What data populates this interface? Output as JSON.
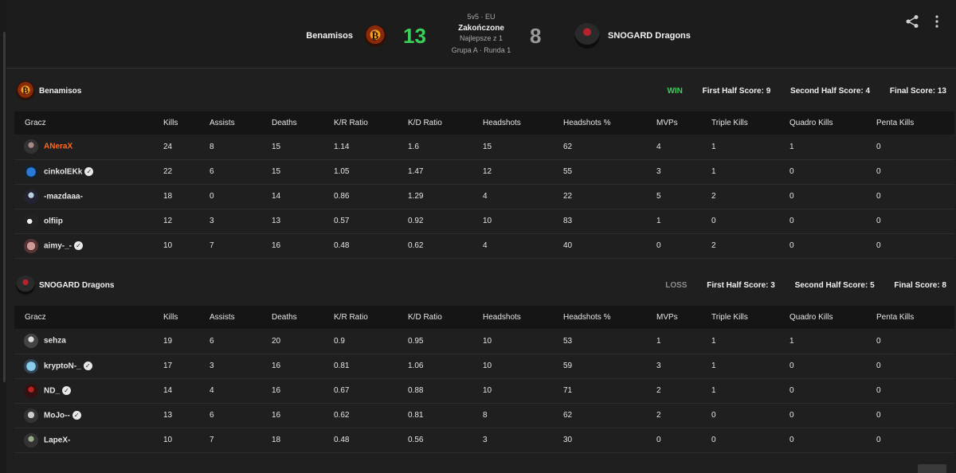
{
  "match": {
    "team_left": "Benamisos",
    "team_right": "SNOGARD Dragons",
    "score_left": "13",
    "score_right": "8",
    "format": "5v5 · EU",
    "status": "Zakończone",
    "best_of": "Najlepsze z 1",
    "group": "Grupa A · Runda 1"
  },
  "columns": [
    "Gracz",
    "Kills",
    "Assists",
    "Deaths",
    "K/R Ratio",
    "K/D Ratio",
    "Headshots",
    "Headshots %",
    "MVPs",
    "Triple Kills",
    "Quadro Kills",
    "Penta Kills"
  ],
  "teams": [
    {
      "name": "Benamisos",
      "result": "WIN",
      "first_half": "First Half Score: 9",
      "second_half": "Second Half Score: 4",
      "final": "Final Score: 13",
      "players": [
        {
          "name": "ANeraX",
          "verified": false,
          "highlight": true,
          "stats": [
            "24",
            "8",
            "15",
            "1.14",
            "1.6",
            "15",
            "62",
            "4",
            "1",
            "1",
            "0"
          ]
        },
        {
          "name": "cinkolEKk",
          "verified": true,
          "highlight": false,
          "stats": [
            "22",
            "6",
            "15",
            "1.05",
            "1.47",
            "12",
            "55",
            "3",
            "1",
            "0",
            "0"
          ]
        },
        {
          "name": "-mazdaaa-",
          "verified": false,
          "highlight": false,
          "stats": [
            "18",
            "0",
            "14",
            "0.86",
            "1.29",
            "4",
            "22",
            "5",
            "2",
            "0",
            "0"
          ]
        },
        {
          "name": "olfiip",
          "verified": false,
          "highlight": false,
          "stats": [
            "12",
            "3",
            "13",
            "0.57",
            "0.92",
            "10",
            "83",
            "1",
            "0",
            "0",
            "0"
          ]
        },
        {
          "name": "aimy-_-",
          "verified": true,
          "highlight": false,
          "stats": [
            "10",
            "7",
            "16",
            "0.48",
            "0.62",
            "4",
            "40",
            "0",
            "2",
            "0",
            "0"
          ]
        }
      ]
    },
    {
      "name": "SNOGARD Dragons",
      "result": "LOSS",
      "first_half": "First Half Score: 3",
      "second_half": "Second Half Score: 5",
      "final": "Final Score: 8",
      "players": [
        {
          "name": "sehza",
          "verified": false,
          "highlight": false,
          "stats": [
            "19",
            "6",
            "20",
            "0.9",
            "0.95",
            "10",
            "53",
            "1",
            "1",
            "1",
            "0"
          ]
        },
        {
          "name": "kryptoN-_",
          "verified": true,
          "highlight": false,
          "stats": [
            "17",
            "3",
            "16",
            "0.81",
            "1.06",
            "10",
            "59",
            "3",
            "1",
            "0",
            "0"
          ]
        },
        {
          "name": "ND_",
          "verified": true,
          "highlight": false,
          "stats": [
            "14",
            "4",
            "16",
            "0.67",
            "0.88",
            "10",
            "71",
            "2",
            "1",
            "0",
            "0"
          ]
        },
        {
          "name": "MoJo--",
          "verified": true,
          "highlight": false,
          "stats": [
            "13",
            "6",
            "16",
            "0.62",
            "0.81",
            "8",
            "62",
            "2",
            "0",
            "0",
            "0"
          ]
        },
        {
          "name": "LapeX-",
          "verified": false,
          "highlight": false,
          "stats": [
            "10",
            "7",
            "18",
            "0.48",
            "0.56",
            "3",
            "30",
            "0",
            "0",
            "0",
            "0"
          ]
        }
      ]
    }
  ],
  "colors": {
    "accent": "#ff5500",
    "win": "#3ccf5a",
    "loss": "#8e8e8e"
  },
  "icons": {
    "share": "share-icon",
    "menu": "kebab-menu-icon",
    "verified": "verified-check-icon"
  }
}
